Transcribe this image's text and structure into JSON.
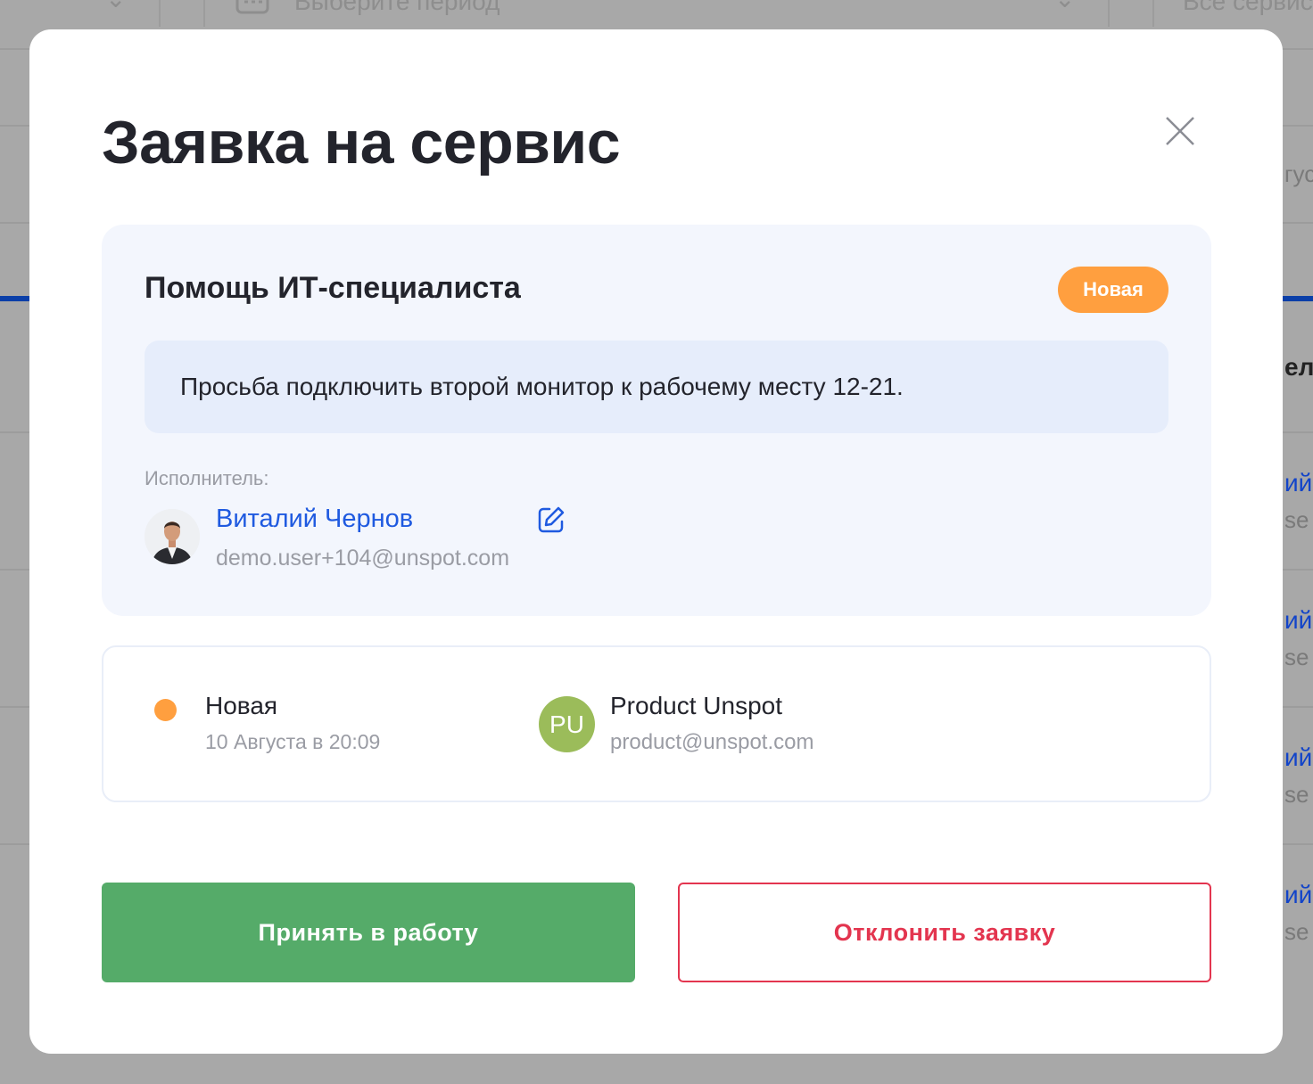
{
  "background": {
    "period_placeholder": "Выберите период",
    "services_filter": "Все сервисы",
    "date_fragment": "гус",
    "column_header_fragment": "ел",
    "row_name_fragment": "ий",
    "row_email_fragment": "se"
  },
  "modal": {
    "title": "Заявка на сервис",
    "close_icon": "close-icon"
  },
  "request": {
    "service_name": "Помощь ИТ-специалиста",
    "status_badge": "Новая",
    "description": "Просьба подключить второй монитор к рабочему месту 12-21.",
    "executor_label": "Исполнитель:",
    "executor": {
      "name": "Виталий Чернов",
      "email": "demo.user+104@unspot.com"
    },
    "edit_icon": "edit-icon"
  },
  "history": {
    "status": "Новая",
    "date": "10 Августа в 20:09",
    "creator": {
      "initials": "PU",
      "name": "Product Unspot",
      "email": "product@unspot.com"
    }
  },
  "actions": {
    "accept_label": "Принять в работу",
    "reject_label": "Отклонить заявку"
  },
  "colors": {
    "accent_blue": "#1f5ae0",
    "status_new": "#ff9f3f",
    "accept": "#55ab69",
    "reject": "#e3354f",
    "creator_avatar": "#9bbc5a"
  }
}
